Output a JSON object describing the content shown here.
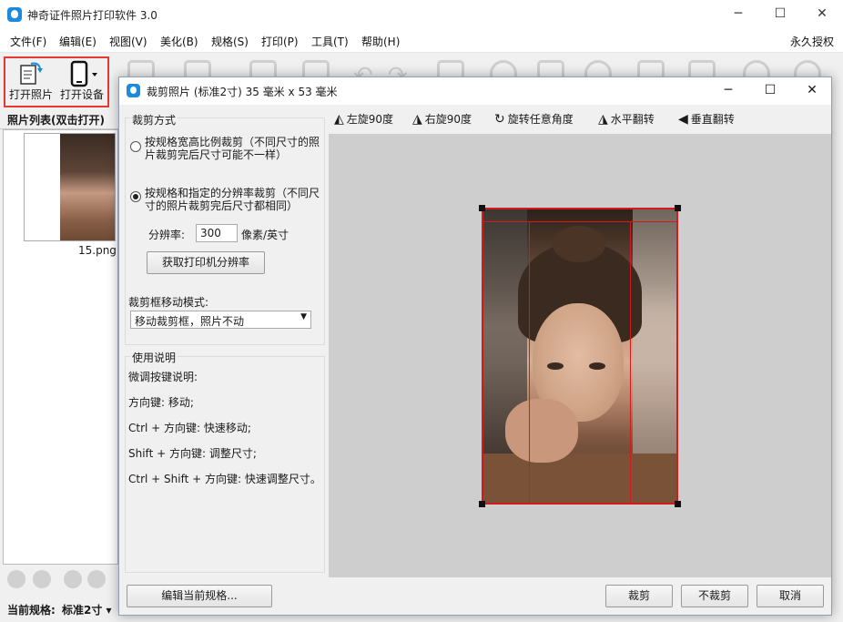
{
  "app": {
    "title": "神奇证件照片打印软件 3.0",
    "window_controls": [
      "─",
      "☐",
      "✕"
    ]
  },
  "menu": {
    "items": [
      "文件(F)",
      "编辑(E)",
      "视图(V)",
      "美化(B)",
      "规格(S)",
      "打印(P)",
      "工具(T)",
      "帮助(H)"
    ],
    "license": "永久授权"
  },
  "toolbar": {
    "open_photo": "打开照片",
    "open_device": "打开设备"
  },
  "photo_list": {
    "header": "照片列表(双击打开)",
    "items": [
      {
        "name": "15.png"
      }
    ]
  },
  "status": {
    "current_spec_label": "当前规格:",
    "current_spec_value": "标准2寸 ▾"
  },
  "dialog": {
    "title": "裁剪照片 (标准2寸) 35 毫米 x 53 毫米",
    "crop_mode": {
      "group_label": "裁剪方式",
      "option1": "按规格宽高比例裁剪（不同尺寸的照片裁剪完后尺寸可能不一样）",
      "option2": "按规格和指定的分辨率裁剪（不同尺寸的照片裁剪完后尺寸都相同）",
      "selected": 2,
      "resolution_label": "分辨率:",
      "resolution_value": "300",
      "resolution_unit": "像素/英寸",
      "get_printer_res": "获取打印机分辨率",
      "move_mode_label": "裁剪框移动模式:",
      "move_mode_value": "移动裁剪框，照片不动"
    },
    "help": {
      "group_label": "使用说明",
      "lines": [
        "微调按键说明:",
        "方向键: 移动;",
        "Ctrl + 方向键: 快速移动;",
        "Shift + 方向键: 调整尺寸;",
        "Ctrl + Shift + 方向键: 快速调整尺寸。"
      ]
    },
    "tools": {
      "rotate_left": "左旋90度",
      "rotate_right": "右旋90度",
      "rotate_any": "旋转任意角度",
      "flip_h": "水平翻转",
      "flip_v": "垂直翻转"
    },
    "buttons": {
      "edit_spec": "编辑当前规格...",
      "crop": "裁剪",
      "no_crop": "不裁剪",
      "cancel": "取消"
    },
    "colors": {
      "crop_frame": "#d01c1c",
      "canvas": "#cecece"
    }
  }
}
